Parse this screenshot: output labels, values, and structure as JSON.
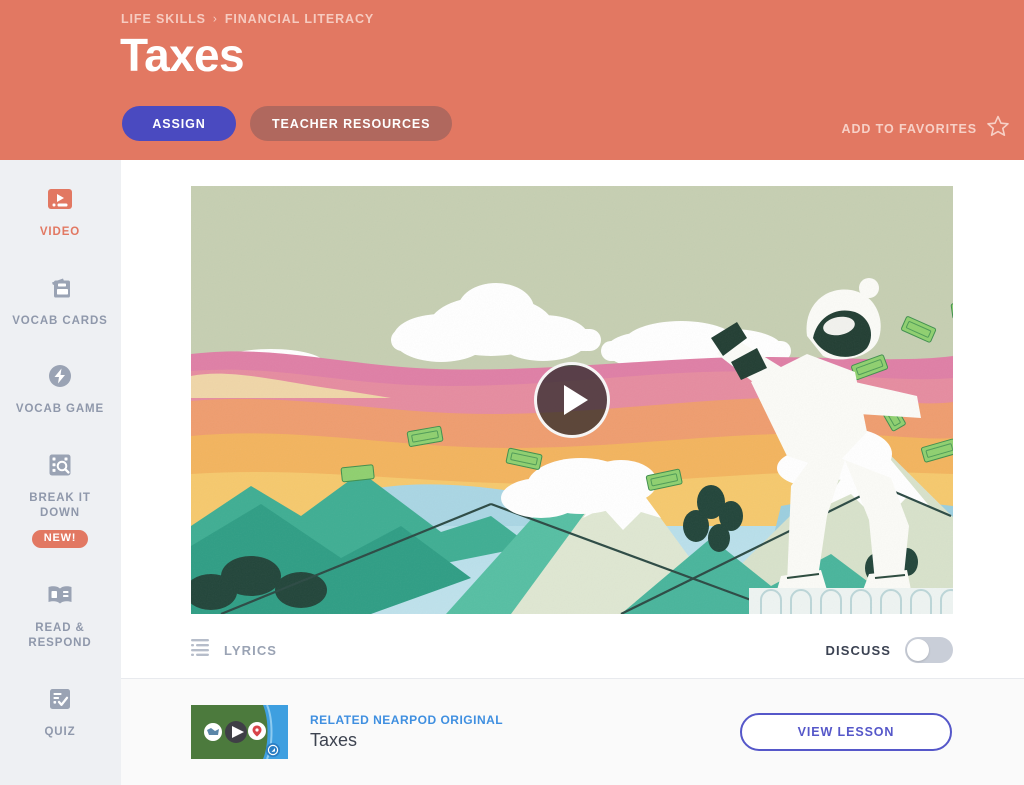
{
  "header": {
    "breadcrumb": [
      "LIFE SKILLS",
      "FINANCIAL LITERACY"
    ],
    "breadcrumb_separator": "›",
    "title": "Taxes",
    "assign_label": "ASSIGN",
    "resources_label": "TEACHER RESOURCES",
    "favorites_label": "ADD TO FAVORITES",
    "favorites_icon": "star-outline-icon",
    "bg_color": "#e27862",
    "assign_color": "#4a4ac0",
    "resources_color": "#b0685e"
  },
  "sidebar": {
    "items": [
      {
        "label": "VIDEO",
        "icon": "video-icon",
        "active": true,
        "badge": null
      },
      {
        "label": "VOCAB CARDS",
        "icon": "cards-icon",
        "active": false,
        "badge": null
      },
      {
        "label": "VOCAB GAME",
        "icon": "lightning-bolt-icon",
        "active": false,
        "badge": null
      },
      {
        "label": "BREAK IT DOWN",
        "icon": "magnifier-grid-icon",
        "active": false,
        "badge": "NEW!"
      },
      {
        "label": "READ & RESPOND",
        "icon": "open-book-icon",
        "active": false,
        "badge": null
      },
      {
        "label": "QUIZ",
        "icon": "checklist-icon",
        "active": false,
        "badge": null
      }
    ],
    "active_color": "#e27862",
    "inactive_color": "#8f98ab"
  },
  "video": {
    "play_icon": "play-button-icon",
    "alt_description": "Illustration of a snowboarder on a mountain with dollar bills flying in a pastel sunset landscape"
  },
  "controls": {
    "lyrics_label": "LYRICS",
    "lyrics_icon": "lyrics-lines-icon",
    "discuss_label": "DISCUSS",
    "discuss_on": false
  },
  "related": {
    "kicker": "RELATED NEARPOD ORIGINAL",
    "title": "Taxes",
    "button_label": "VIEW LESSON",
    "thumb_icons": [
      "map-icon",
      "play-icon",
      "map-pin-icon",
      "compass-icon"
    ],
    "kicker_color": "#3f8fe0",
    "button_color": "#5557c9"
  }
}
